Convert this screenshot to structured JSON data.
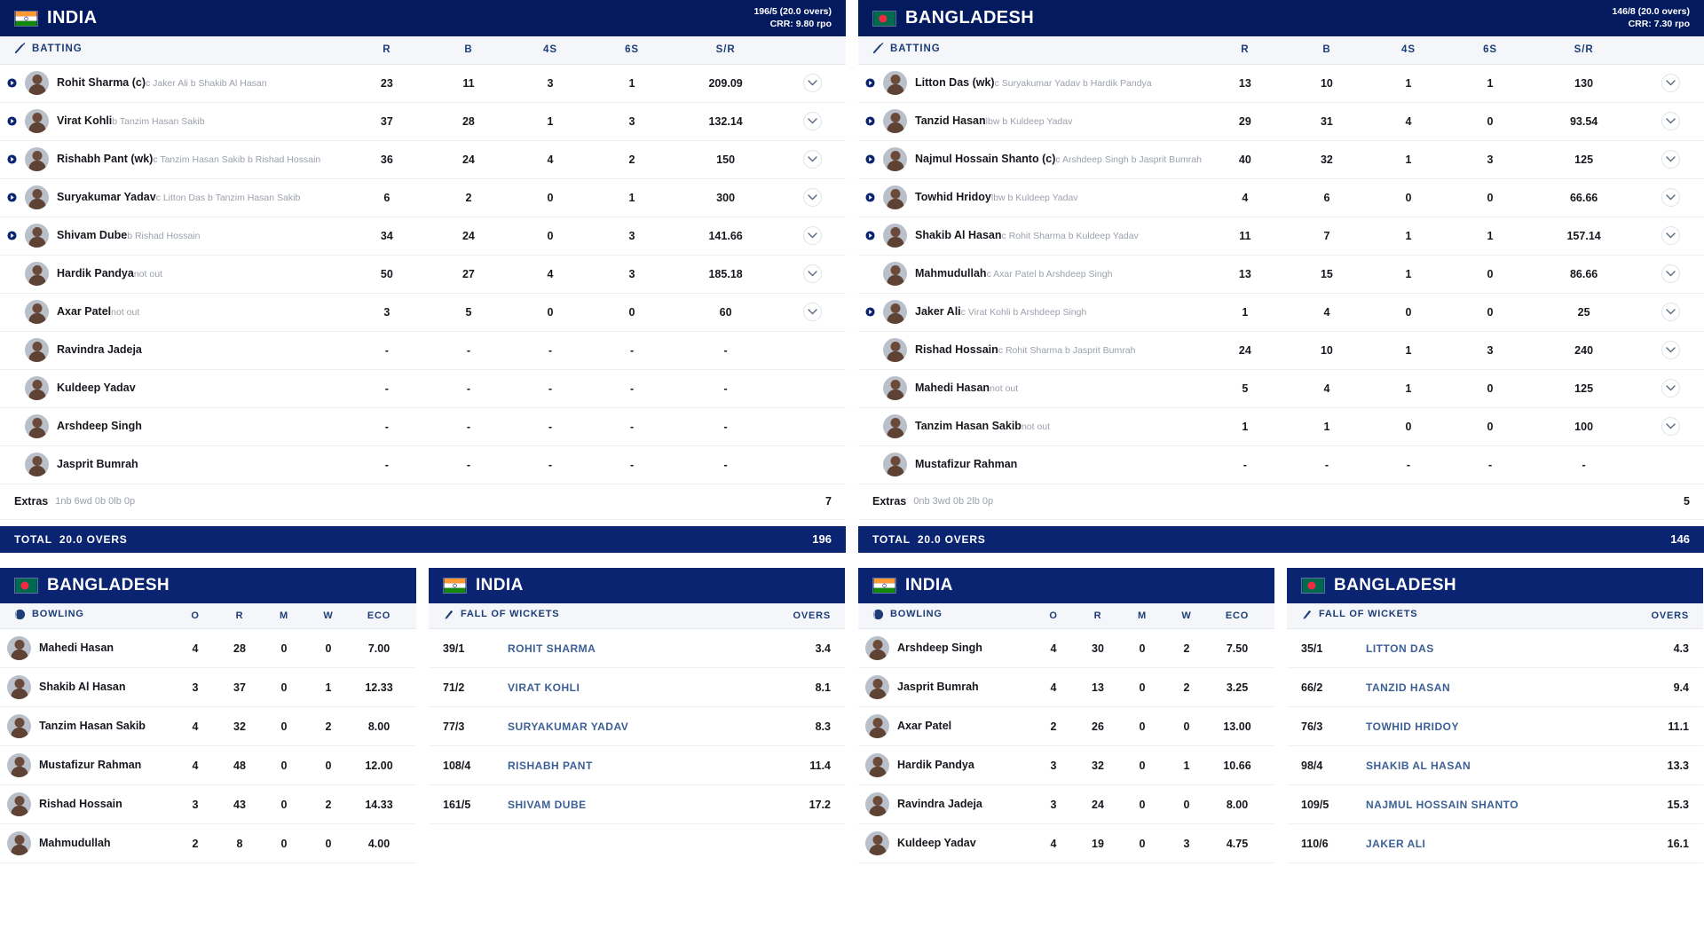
{
  "innings": [
    {
      "id": "india-innings",
      "team": "INDIA",
      "flag": "india-flag",
      "score": "196/5 (20.0 overs)",
      "crr": "CRR: 9.80 rpo",
      "batting_header": {
        "label": "BATTING",
        "icon": "bat-icon",
        "cols": [
          "R",
          "B",
          "4S",
          "6S",
          "S/R"
        ]
      },
      "batsmen": [
        {
          "name": "Rohit Sharma (c)",
          "dismissal": "c Jaker Ali b Shakib Al Hasan",
          "r": "23",
          "b": "11",
          "fours": "3",
          "sixes": "1",
          "sr": "209.09",
          "out": true,
          "expand": true
        },
        {
          "name": "Virat Kohli",
          "dismissal": "b Tanzim Hasan Sakib",
          "r": "37",
          "b": "28",
          "fours": "1",
          "sixes": "3",
          "sr": "132.14",
          "out": true,
          "expand": true
        },
        {
          "name": "Rishabh Pant (wk)",
          "dismissal": "c Tanzim Hasan Sakib b Rishad Hossain",
          "r": "36",
          "b": "24",
          "fours": "4",
          "sixes": "2",
          "sr": "150",
          "out": true,
          "expand": true
        },
        {
          "name": "Suryakumar Yadav",
          "dismissal": "c Litton Das b Tanzim Hasan Sakib",
          "r": "6",
          "b": "2",
          "fours": "0",
          "sixes": "1",
          "sr": "300",
          "out": true,
          "expand": true
        },
        {
          "name": "Shivam Dube",
          "dismissal": "b Rishad Hossain",
          "r": "34",
          "b": "24",
          "fours": "0",
          "sixes": "3",
          "sr": "141.66",
          "out": true,
          "expand": true
        },
        {
          "name": "Hardik Pandya",
          "dismissal": "not out",
          "r": "50",
          "b": "27",
          "fours": "4",
          "sixes": "3",
          "sr": "185.18",
          "out": false,
          "expand": true
        },
        {
          "name": "Axar Patel",
          "dismissal": "not out",
          "r": "3",
          "b": "5",
          "fours": "0",
          "sixes": "0",
          "sr": "60",
          "out": false,
          "expand": true
        },
        {
          "name": "Ravindra Jadeja",
          "dismissal": "",
          "r": "-",
          "b": "-",
          "fours": "-",
          "sixes": "-",
          "sr": "-",
          "out": false,
          "expand": false
        },
        {
          "name": "Kuldeep Yadav",
          "dismissal": "",
          "r": "-",
          "b": "-",
          "fours": "-",
          "sixes": "-",
          "sr": "-",
          "out": false,
          "expand": false
        },
        {
          "name": "Arshdeep Singh",
          "dismissal": "",
          "r": "-",
          "b": "-",
          "fours": "-",
          "sixes": "-",
          "sr": "-",
          "out": false,
          "expand": false
        },
        {
          "name": "Jasprit Bumrah",
          "dismissal": "",
          "r": "-",
          "b": "-",
          "fours": "-",
          "sixes": "-",
          "sr": "-",
          "out": false,
          "expand": false
        }
      ],
      "extras": {
        "label": "Extras",
        "detail": "1nb 6wd 0b 0lb 0p",
        "value": "7"
      },
      "total": {
        "label": "TOTAL",
        "overs": "20.0 OVERS",
        "value": "196"
      }
    },
    {
      "id": "bangladesh-innings",
      "team": "BANGLADESH",
      "flag": "bangladesh-flag",
      "score": "146/8 (20.0 overs)",
      "crr": "CRR: 7.30 rpo",
      "batting_header": {
        "label": "BATTING",
        "icon": "bat-icon",
        "cols": [
          "R",
          "B",
          "4S",
          "6S",
          "S/R"
        ]
      },
      "batsmen": [
        {
          "name": "Litton Das (wk)",
          "dismissal": "c Suryakumar Yadav b Hardik Pandya",
          "r": "13",
          "b": "10",
          "fours": "1",
          "sixes": "1",
          "sr": "130",
          "out": true,
          "expand": true
        },
        {
          "name": "Tanzid Hasan",
          "dismissal": "lbw b Kuldeep Yadav",
          "r": "29",
          "b": "31",
          "fours": "4",
          "sixes": "0",
          "sr": "93.54",
          "out": true,
          "expand": true
        },
        {
          "name": "Najmul Hossain Shanto (c)",
          "dismissal": "c Arshdeep Singh b Jasprit Bumrah",
          "r": "40",
          "b": "32",
          "fours": "1",
          "sixes": "3",
          "sr": "125",
          "out": true,
          "expand": true
        },
        {
          "name": "Towhid Hridoy",
          "dismissal": "lbw b Kuldeep Yadav",
          "r": "4",
          "b": "6",
          "fours": "0",
          "sixes": "0",
          "sr": "66.66",
          "out": true,
          "expand": true
        },
        {
          "name": "Shakib Al Hasan",
          "dismissal": "c Rohit Sharma b Kuldeep Yadav",
          "r": "11",
          "b": "7",
          "fours": "1",
          "sixes": "1",
          "sr": "157.14",
          "out": true,
          "expand": true
        },
        {
          "name": "Mahmudullah",
          "dismissal": "c Axar Patel b Arshdeep Singh",
          "r": "13",
          "b": "15",
          "fours": "1",
          "sixes": "0",
          "sr": "86.66",
          "out": false,
          "expand": true
        },
        {
          "name": "Jaker Ali",
          "dismissal": "c Virat Kohli b Arshdeep Singh",
          "r": "1",
          "b": "4",
          "fours": "0",
          "sixes": "0",
          "sr": "25",
          "out": true,
          "expand": true
        },
        {
          "name": "Rishad Hossain",
          "dismissal": "c Rohit Sharma b Jasprit Bumrah",
          "r": "24",
          "b": "10",
          "fours": "1",
          "sixes": "3",
          "sr": "240",
          "out": false,
          "expand": true
        },
        {
          "name": "Mahedi Hasan",
          "dismissal": "not out",
          "r": "5",
          "b": "4",
          "fours": "1",
          "sixes": "0",
          "sr": "125",
          "out": false,
          "expand": true
        },
        {
          "name": "Tanzim Hasan Sakib",
          "dismissal": "not out",
          "r": "1",
          "b": "1",
          "fours": "0",
          "sixes": "0",
          "sr": "100",
          "out": false,
          "expand": true
        },
        {
          "name": "Mustafizur Rahman",
          "dismissal": "",
          "r": "-",
          "b": "-",
          "fours": "-",
          "sixes": "-",
          "sr": "-",
          "out": false,
          "expand": false
        }
      ],
      "extras": {
        "label": "Extras",
        "detail": "0nb 3wd 0b 2lb 0p",
        "value": "5"
      },
      "total": {
        "label": "TOTAL",
        "overs": "20.0 OVERS",
        "value": "146"
      }
    }
  ],
  "bottom_panels": [
    {
      "id": "bangladesh-bowling",
      "team": "BANGLADESH",
      "flag": "bangladesh-flag",
      "header": {
        "label": "BOWLING",
        "icon": "ball-icon",
        "cols": [
          "O",
          "R",
          "M",
          "W",
          "ECO"
        ]
      },
      "bowlers": [
        {
          "name": "Mahedi Hasan",
          "o": "4",
          "r": "28",
          "m": "0",
          "w": "0",
          "eco": "7.00"
        },
        {
          "name": "Shakib Al Hasan",
          "o": "3",
          "r": "37",
          "m": "0",
          "w": "1",
          "eco": "12.33"
        },
        {
          "name": "Tanzim Hasan Sakib",
          "o": "4",
          "r": "32",
          "m": "0",
          "w": "2",
          "eco": "8.00"
        },
        {
          "name": "Mustafizur Rahman",
          "o": "4",
          "r": "48",
          "m": "0",
          "w": "0",
          "eco": "12.00"
        },
        {
          "name": "Rishad Hossain",
          "o": "3",
          "r": "43",
          "m": "0",
          "w": "2",
          "eco": "14.33"
        },
        {
          "name": "Mahmudullah",
          "o": "2",
          "r": "8",
          "m": "0",
          "w": "0",
          "eco": "4.00"
        }
      ]
    },
    {
      "id": "india-fall-of-wickets",
      "team": "INDIA",
      "flag": "india-flag",
      "header": {
        "label": "FALL OF WICKETS",
        "icon": "fow-icon",
        "overs_col": "OVERS"
      },
      "wickets": [
        {
          "score": "39/1",
          "name": "ROHIT SHARMA",
          "overs": "3.4"
        },
        {
          "score": "71/2",
          "name": "VIRAT KOHLI",
          "overs": "8.1"
        },
        {
          "score": "77/3",
          "name": "SURYAKUMAR YADAV",
          "overs": "8.3"
        },
        {
          "score": "108/4",
          "name": "RISHABH PANT",
          "overs": "11.4"
        },
        {
          "score": "161/5",
          "name": "SHIVAM DUBE",
          "overs": "17.2"
        }
      ]
    },
    {
      "id": "india-bowling",
      "team": "INDIA",
      "flag": "india-flag",
      "header": {
        "label": "BOWLING",
        "icon": "ball-icon",
        "cols": [
          "O",
          "R",
          "M",
          "W",
          "ECO"
        ]
      },
      "bowlers": [
        {
          "name": "Arshdeep Singh",
          "o": "4",
          "r": "30",
          "m": "0",
          "w": "2",
          "eco": "7.50"
        },
        {
          "name": "Jasprit Bumrah",
          "o": "4",
          "r": "13",
          "m": "0",
          "w": "2",
          "eco": "3.25"
        },
        {
          "name": "Axar Patel",
          "o": "2",
          "r": "26",
          "m": "0",
          "w": "0",
          "eco": "13.00"
        },
        {
          "name": "Hardik Pandya",
          "o": "3",
          "r": "32",
          "m": "0",
          "w": "1",
          "eco": "10.66"
        },
        {
          "name": "Ravindra Jadeja",
          "o": "3",
          "r": "24",
          "m": "0",
          "w": "0",
          "eco": "8.00"
        },
        {
          "name": "Kuldeep Yadav",
          "o": "4",
          "r": "19",
          "m": "0",
          "w": "3",
          "eco": "4.75"
        }
      ]
    },
    {
      "id": "bangladesh-fall-of-wickets",
      "team": "BANGLADESH",
      "flag": "bangladesh-flag",
      "header": {
        "label": "FALL OF WICKETS",
        "icon": "fow-icon",
        "overs_col": "OVERS"
      },
      "wickets": [
        {
          "score": "35/1",
          "name": "LITTON DAS",
          "overs": "4.3"
        },
        {
          "score": "66/2",
          "name": "TANZID HASAN",
          "overs": "9.4"
        },
        {
          "score": "76/3",
          "name": "TOWHID HRIDOY",
          "overs": "11.1"
        },
        {
          "score": "98/4",
          "name": "SHAKIB AL HASAN",
          "overs": "13.3"
        },
        {
          "score": "109/5",
          "name": "NAJMUL HOSSAIN SHANTO",
          "overs": "15.3"
        },
        {
          "score": "110/6",
          "name": "JAKER ALI",
          "overs": "16.1"
        }
      ]
    }
  ],
  "colors": {
    "header_navy": "#031a5f",
    "bar_navy": "#0a2472",
    "accent_blue": "#3c6096",
    "muted": "#9aa0ab"
  }
}
